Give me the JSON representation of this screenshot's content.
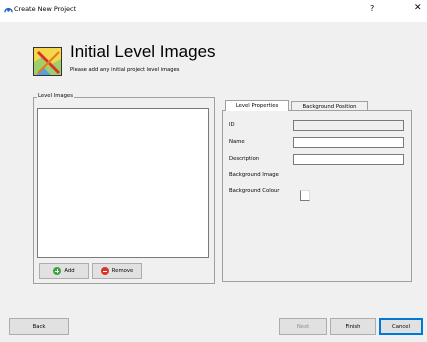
{
  "window": {
    "title": "Create New Project",
    "help_label": "?",
    "close_label": "✕"
  },
  "header": {
    "title": "Initial Level Images",
    "subtitle": "Please add any initial project level images"
  },
  "level_images": {
    "group_label": "Level Images",
    "items": [],
    "add_label": "Add",
    "remove_label": "Remove"
  },
  "properties": {
    "tabs": [
      {
        "label": "Level Properties",
        "active": true
      },
      {
        "label": "Background Position",
        "active": false
      }
    ],
    "fields": {
      "id_label": "ID",
      "id_value": "",
      "name_label": "Name",
      "name_value": "",
      "description_label": "Description",
      "description_value": "",
      "background_image_label": "Background Image",
      "background_colour_label": "Background Colour"
    }
  },
  "footer": {
    "back_label": "Back",
    "next_label": "Next",
    "finish_label": "Finish",
    "cancel_label": "Cancel"
  },
  "colors": {
    "background": "#f0f0f0",
    "default_button_border": "#0078d7",
    "add_icon": "#3ba542",
    "remove_icon": "#d9342b"
  }
}
